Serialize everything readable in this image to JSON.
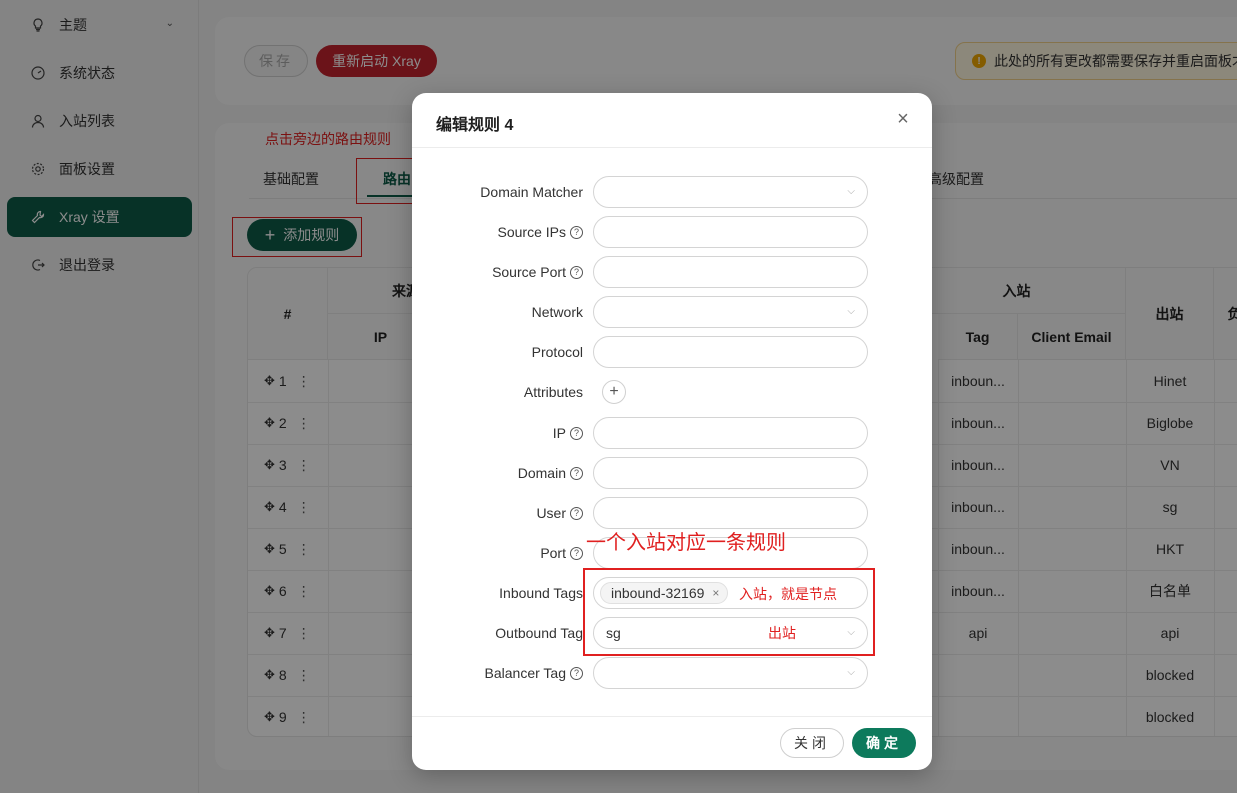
{
  "sidebar": {
    "items": [
      {
        "label": "主题",
        "icon": "bulb-icon"
      },
      {
        "label": "系统状态",
        "icon": "dashboard-icon"
      },
      {
        "label": "入站列表",
        "icon": "user-icon"
      },
      {
        "label": "面板设置",
        "icon": "gear-icon"
      },
      {
        "label": "Xray 设置",
        "icon": "tool-icon"
      },
      {
        "label": "退出登录",
        "icon": "logout-icon"
      }
    ]
  },
  "toolbar": {
    "save_label": "保存",
    "restart_label": "重新启动 Xray",
    "alert_text": "此处的所有更改都需要保存并重启面板才"
  },
  "main": {
    "hint": "点击旁边的路由规则",
    "tabs": [
      "基础配置",
      "路由",
      "高级配置"
    ],
    "add_rule_label": "添加规则",
    "table": {
      "headers": {
        "index": "#",
        "source": "来源",
        "ip": "IP",
        "inbound": "入站",
        "tag": "Tag",
        "client_email": "Client Email",
        "outbound": "出站",
        "balancer": "负"
      },
      "rows": [
        {
          "n": "1",
          "tag": "inboun...",
          "out": "Hinet"
        },
        {
          "n": "2",
          "tag": "inboun...",
          "out": "Biglobe"
        },
        {
          "n": "3",
          "tag": "inboun...",
          "out": "VN"
        },
        {
          "n": "4",
          "tag": "inboun...",
          "out": "sg"
        },
        {
          "n": "5",
          "tag": "inboun...",
          "out": "HKT"
        },
        {
          "n": "6",
          "tag": "inboun...",
          "out": "白名单"
        },
        {
          "n": "7",
          "tag": "api",
          "out": "api"
        },
        {
          "n": "8",
          "tag": "",
          "out": "blocked"
        },
        {
          "n": "9",
          "tag": "",
          "out": "blocked"
        }
      ]
    }
  },
  "modal": {
    "title": "编辑规则 4",
    "fields": {
      "domain_matcher": "Domain Matcher",
      "source_ips": "Source IPs",
      "source_port": "Source Port",
      "network": "Network",
      "protocol": "Protocol",
      "attributes": "Attributes",
      "ip": "IP",
      "domain": "Domain",
      "user": "User",
      "port": "Port",
      "inbound_tags": "Inbound Tags",
      "outbound_tag": "Outbound Tag",
      "balancer_tag": "Balancer Tag"
    },
    "inbound_tag_value": "inbound-32169",
    "outbound_tag_value": "sg",
    "annotations": {
      "rule": "一个入站对应一条规则",
      "inbound": "入站，就是节点",
      "outbound": "出站"
    },
    "close_label": "关闭",
    "ok_label": "确定"
  }
}
